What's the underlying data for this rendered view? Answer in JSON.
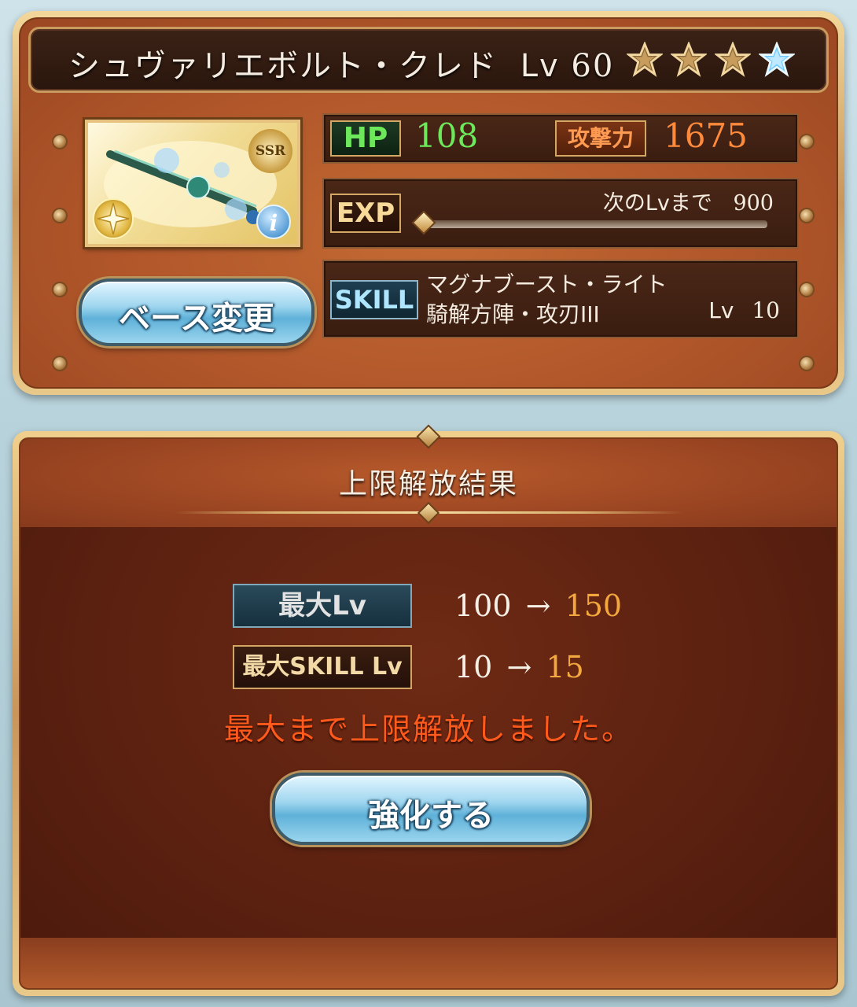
{
  "weapon": {
    "name": "シュヴァリエボルト・クレド",
    "level_label": "Lv",
    "level": "60",
    "rarity_badge": "SSR",
    "stars_total": 4,
    "stars_gold": 3,
    "stars_blue": 1
  },
  "stats": {
    "hp_label": "HP",
    "hp_value": "108",
    "atk_label": "攻撃力",
    "atk_value": "1675",
    "exp_label": "EXP",
    "exp_next_text": "次のLvまで",
    "exp_next_value": "900",
    "exp_progress": 0,
    "skill_label": "SKILL",
    "skill_line1": "マグナブースト・ライト",
    "skill_line2": "騎解方陣・攻刃III",
    "skill_level_label": "Lv",
    "skill_level": "10"
  },
  "buttons": {
    "base_change": "ベース変更",
    "enhance": "強化する"
  },
  "icons": {
    "element": "light-element-icon",
    "info": "info-icon",
    "star": "star-icon"
  },
  "result": {
    "title": "上限解放結果",
    "max_lv_label": "最大Lv",
    "max_lv_from": "100",
    "max_lv_arrow": "→",
    "max_lv_to": "150",
    "max_skill_label": "最大SKILL Lv",
    "max_skill_from": "10",
    "max_skill_arrow": "→",
    "max_skill_to": "15",
    "notice": "最大まで上限解放しました。"
  },
  "colors": {
    "hp_green": "#6de85a",
    "atk_orange": "#ff8a3c",
    "new_value_orange": "#f3a83f",
    "notice_red": "#ff5a1c"
  }
}
